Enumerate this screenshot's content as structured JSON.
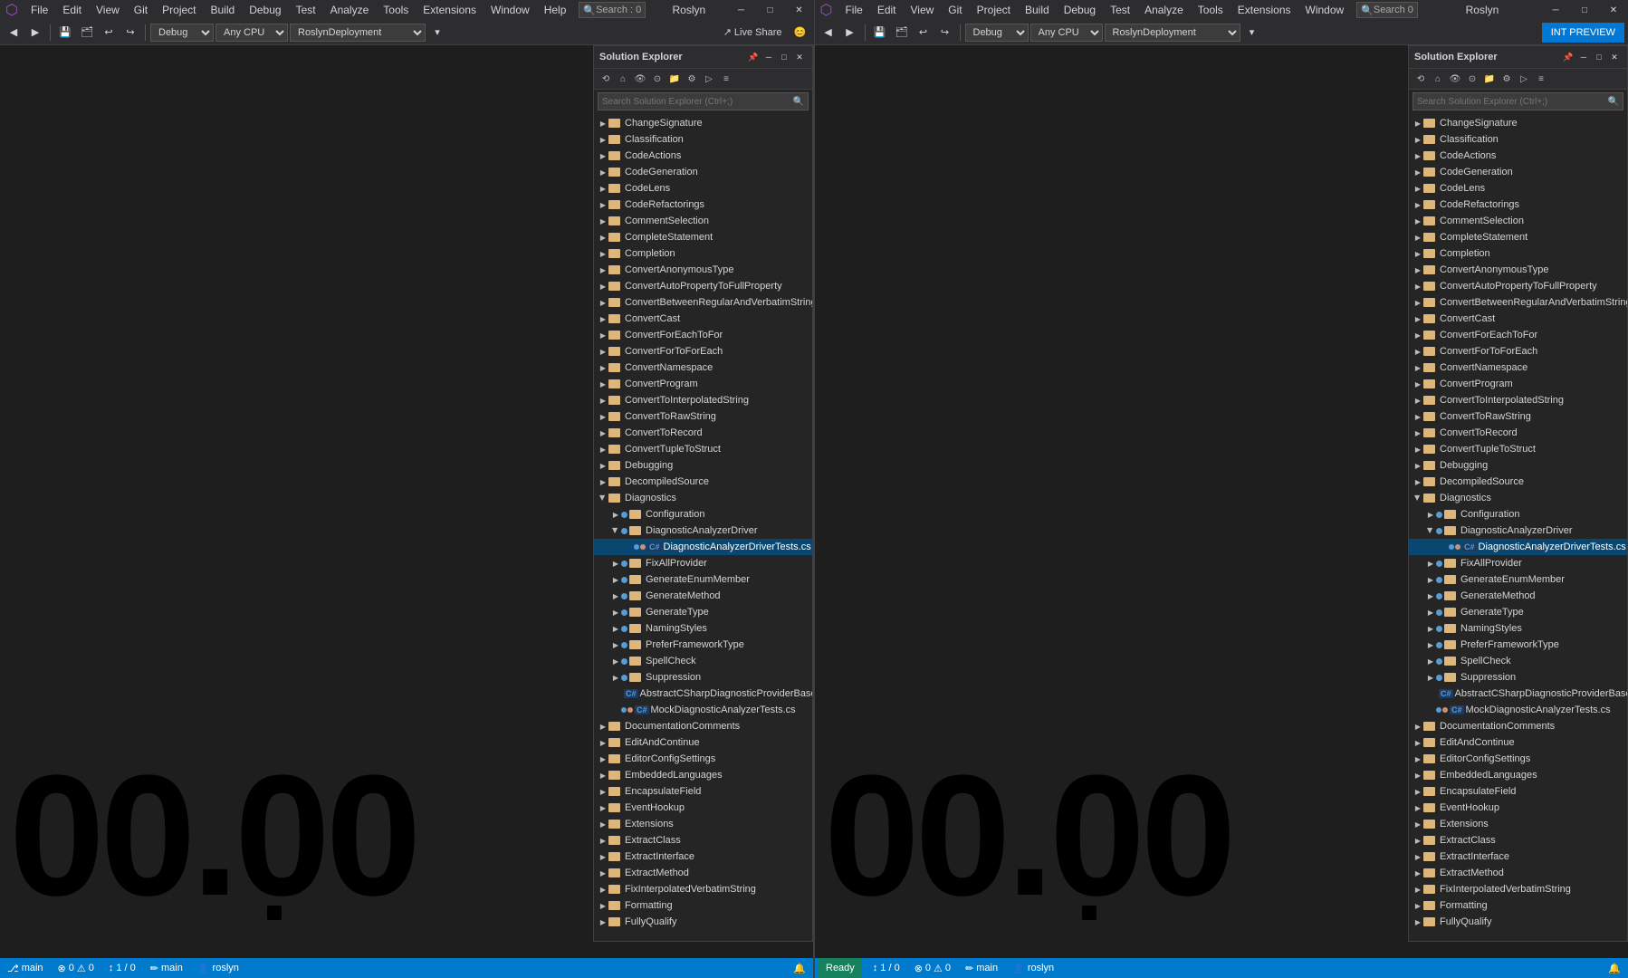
{
  "menuBar": {
    "left": {
      "items": [
        "File",
        "Edit",
        "View",
        "Git",
        "Project",
        "Build",
        "Debug",
        "Test",
        "Analyze",
        "Tools",
        "Extensions",
        "Window",
        "Help"
      ]
    },
    "right": {
      "items": [
        "File",
        "Edit",
        "View",
        "Git",
        "Project",
        "Build",
        "Debug",
        "Test",
        "Analyze",
        "Tools",
        "Extensions",
        "Window"
      ]
    },
    "searchLeft": "Search : 0",
    "searchRight": "Search  0",
    "titleLeft": "Roslyn",
    "titleRight": "Roslyn"
  },
  "toolbar": {
    "debugMode": "Debug",
    "platformLeft": "Any CPU",
    "platformRight": "Any CPU",
    "projectLeft": "RoslynDeployment",
    "projectRight": "RoslynDeployment",
    "liveShare": "Live Share",
    "intPreview": "INT PREVIEW"
  },
  "leftPanel": {
    "solutionExplorer": {
      "title": "Solution Explorer",
      "searchPlaceholder": "Search Solution Explorer (Ctrl+;)",
      "treeItems": [
        {
          "level": 1,
          "type": "folder",
          "label": "ChangeSignature",
          "expanded": false
        },
        {
          "level": 1,
          "type": "folder",
          "label": "Classification",
          "expanded": false
        },
        {
          "level": 1,
          "type": "folder",
          "label": "CodeActions",
          "expanded": false
        },
        {
          "level": 1,
          "type": "folder",
          "label": "CodeGeneration",
          "expanded": false
        },
        {
          "level": 1,
          "type": "folder",
          "label": "CodeLens",
          "expanded": false
        },
        {
          "level": 1,
          "type": "folder",
          "label": "CodeRefactorings",
          "expanded": false
        },
        {
          "level": 1,
          "type": "folder",
          "label": "CommentSelection",
          "expanded": false
        },
        {
          "level": 1,
          "type": "folder",
          "label": "CompleteStatement",
          "expanded": false
        },
        {
          "level": 1,
          "type": "folder",
          "label": "Completion",
          "expanded": false
        },
        {
          "level": 1,
          "type": "folder",
          "label": "ConvertAnonymousType",
          "expanded": false
        },
        {
          "level": 1,
          "type": "folder",
          "label": "ConvertAutoPropertyToFullProperty",
          "expanded": false
        },
        {
          "level": 1,
          "type": "folder",
          "label": "ConvertBetweenRegularAndVerbatimString",
          "expanded": false
        },
        {
          "level": 1,
          "type": "folder",
          "label": "ConvertCast",
          "expanded": false
        },
        {
          "level": 1,
          "type": "folder",
          "label": "ConvertForEachToFor",
          "expanded": false
        },
        {
          "level": 1,
          "type": "folder",
          "label": "ConvertForToForEach",
          "expanded": false
        },
        {
          "level": 1,
          "type": "folder",
          "label": "ConvertNamespace",
          "expanded": false
        },
        {
          "level": 1,
          "type": "folder",
          "label": "ConvertProgram",
          "expanded": false
        },
        {
          "level": 1,
          "type": "folder",
          "label": "ConvertToInterpolatedString",
          "expanded": false
        },
        {
          "level": 1,
          "type": "folder",
          "label": "ConvertToRawString",
          "expanded": false
        },
        {
          "level": 1,
          "type": "folder",
          "label": "ConvertToRecord",
          "expanded": false
        },
        {
          "level": 1,
          "type": "folder",
          "label": "ConvertTupleToStruct",
          "expanded": false
        },
        {
          "level": 1,
          "type": "folder",
          "label": "Debugging",
          "expanded": false
        },
        {
          "level": 1,
          "type": "folder",
          "label": "DecompiledSource",
          "expanded": false
        },
        {
          "level": 1,
          "type": "folder",
          "label": "Diagnostics",
          "expanded": true
        },
        {
          "level": 2,
          "type": "folder",
          "label": "Configuration",
          "expanded": false
        },
        {
          "level": 2,
          "type": "folder",
          "label": "DiagnosticAnalyzerDriver",
          "expanded": true
        },
        {
          "level": 3,
          "type": "csfile",
          "label": "DiagnosticAnalyzerDriverTests.cs",
          "selected": true
        },
        {
          "level": 2,
          "type": "folder",
          "label": "FixAllProvider",
          "expanded": false
        },
        {
          "level": 2,
          "type": "folder",
          "label": "GenerateEnumMember",
          "expanded": false
        },
        {
          "level": 2,
          "type": "folder",
          "label": "GenerateMethod",
          "expanded": false
        },
        {
          "level": 2,
          "type": "folder",
          "label": "GenerateType",
          "expanded": false
        },
        {
          "level": 2,
          "type": "folder",
          "label": "NamingStyles",
          "expanded": false
        },
        {
          "level": 2,
          "type": "folder",
          "label": "PreferFrameworkType",
          "expanded": false
        },
        {
          "level": 2,
          "type": "folder",
          "label": "SpellCheck",
          "expanded": false
        },
        {
          "level": 2,
          "type": "folder",
          "label": "Suppression",
          "expanded": false
        },
        {
          "level": 2,
          "type": "csfile",
          "label": "AbstractCSharpDiagnosticProviderBase",
          "expanded": false
        },
        {
          "level": 2,
          "type": "csfile",
          "label": "MockDiagnosticAnalyzerTests.cs",
          "expanded": false
        },
        {
          "level": 1,
          "type": "folder",
          "label": "DocumentationComments",
          "expanded": false
        },
        {
          "level": 1,
          "type": "folder",
          "label": "EditAndContinue",
          "expanded": false
        },
        {
          "level": 1,
          "type": "folder",
          "label": "EditorConfigSettings",
          "expanded": false
        },
        {
          "level": 1,
          "type": "folder",
          "label": "EmbeddedLanguages",
          "expanded": false
        },
        {
          "level": 1,
          "type": "folder",
          "label": "EncapsulateField",
          "expanded": false
        },
        {
          "level": 1,
          "type": "folder",
          "label": "EventHookup",
          "expanded": false
        },
        {
          "level": 1,
          "type": "folder",
          "label": "Extensions",
          "expanded": false
        },
        {
          "level": 1,
          "type": "folder",
          "label": "ExtractClass",
          "expanded": false
        },
        {
          "level": 1,
          "type": "folder",
          "label": "ExtractInterface",
          "expanded": false
        },
        {
          "level": 1,
          "type": "folder",
          "label": "ExtractMethod",
          "expanded": false
        },
        {
          "level": 1,
          "type": "folder",
          "label": "FixInterpolatedVerbatimString",
          "expanded": false
        },
        {
          "level": 1,
          "type": "folder",
          "label": "Formatting",
          "expanded": false
        },
        {
          "level": 1,
          "type": "folder",
          "label": "FullyQualify",
          "expanded": false
        }
      ]
    },
    "bigNumber": "00.00",
    "statusBar": {
      "branch": "main",
      "user": "roslyn",
      "errors": "0",
      "warnings": "0",
      "lineCol": "1 / 0"
    }
  },
  "rightPanel": {
    "solutionExplorer": {
      "title": "Solution Explorer",
      "searchPlaceholder": "Search Solution Explorer (Ctrl+;)",
      "treeItems": [
        {
          "level": 1,
          "type": "folder",
          "label": "ChangeSignature",
          "expanded": false
        },
        {
          "level": 1,
          "type": "folder",
          "label": "Classification",
          "expanded": false
        },
        {
          "level": 1,
          "type": "folder",
          "label": "CodeActions",
          "expanded": false
        },
        {
          "level": 1,
          "type": "folder",
          "label": "CodeGeneration",
          "expanded": false
        },
        {
          "level": 1,
          "type": "folder",
          "label": "CodeLens",
          "expanded": false
        },
        {
          "level": 1,
          "type": "folder",
          "label": "CodeRefactorings",
          "expanded": false
        },
        {
          "level": 1,
          "type": "folder",
          "label": "CommentSelection",
          "expanded": false
        },
        {
          "level": 1,
          "type": "folder",
          "label": "CompleteStatement",
          "expanded": false
        },
        {
          "level": 1,
          "type": "folder",
          "label": "Completion",
          "expanded": false
        },
        {
          "level": 1,
          "type": "folder",
          "label": "ConvertAnonymousType",
          "expanded": false
        },
        {
          "level": 1,
          "type": "folder",
          "label": "ConvertAutoPropertyToFullProperty",
          "expanded": false
        },
        {
          "level": 1,
          "type": "folder",
          "label": "ConvertBetweenRegularAndVerbatimString",
          "expanded": false
        },
        {
          "level": 1,
          "type": "folder",
          "label": "ConvertCast",
          "expanded": false
        },
        {
          "level": 1,
          "type": "folder",
          "label": "ConvertForEachToFor",
          "expanded": false
        },
        {
          "level": 1,
          "type": "folder",
          "label": "ConvertForToForEach",
          "expanded": false
        },
        {
          "level": 1,
          "type": "folder",
          "label": "ConvertNamespace",
          "expanded": false
        },
        {
          "level": 1,
          "type": "folder",
          "label": "ConvertProgram",
          "expanded": false
        },
        {
          "level": 1,
          "type": "folder",
          "label": "ConvertToInterpolatedString",
          "expanded": false
        },
        {
          "level": 1,
          "type": "folder",
          "label": "ConvertToRawString",
          "expanded": false
        },
        {
          "level": 1,
          "type": "folder",
          "label": "ConvertToRecord",
          "expanded": false
        },
        {
          "level": 1,
          "type": "folder",
          "label": "ConvertTupleToStruct",
          "expanded": false
        },
        {
          "level": 1,
          "type": "folder",
          "label": "Debugging",
          "expanded": false
        },
        {
          "level": 1,
          "type": "folder",
          "label": "DecompiledSource",
          "expanded": false
        },
        {
          "level": 1,
          "type": "folder",
          "label": "Diagnostics",
          "expanded": true
        },
        {
          "level": 2,
          "type": "folder",
          "label": "Configuration",
          "expanded": false
        },
        {
          "level": 2,
          "type": "folder",
          "label": "DiagnosticAnalyzerDriver",
          "expanded": true
        },
        {
          "level": 3,
          "type": "csfile",
          "label": "DiagnosticAnalyzerDriverTests.cs",
          "selected": true
        },
        {
          "level": 2,
          "type": "folder",
          "label": "FixAllProvider",
          "expanded": false
        },
        {
          "level": 2,
          "type": "folder",
          "label": "GenerateEnumMember",
          "expanded": false
        },
        {
          "level": 2,
          "type": "folder",
          "label": "GenerateMethod",
          "expanded": false
        },
        {
          "level": 2,
          "type": "folder",
          "label": "GenerateType",
          "expanded": false
        },
        {
          "level": 2,
          "type": "folder",
          "label": "NamingStyles",
          "expanded": false
        },
        {
          "level": 2,
          "type": "folder",
          "label": "PreferFrameworkType",
          "expanded": false
        },
        {
          "level": 2,
          "type": "folder",
          "label": "SpellCheck",
          "expanded": false
        },
        {
          "level": 2,
          "type": "folder",
          "label": "Suppression",
          "expanded": false
        },
        {
          "level": 2,
          "type": "csfile",
          "label": "AbstractCSharpDiagnosticProviderBase",
          "expanded": false
        },
        {
          "level": 2,
          "type": "csfile",
          "label": "MockDiagnosticAnalyzerTests.cs",
          "expanded": false
        },
        {
          "level": 1,
          "type": "folder",
          "label": "DocumentationComments",
          "expanded": false
        },
        {
          "level": 1,
          "type": "folder",
          "label": "EditAndContinue",
          "expanded": false
        },
        {
          "level": 1,
          "type": "folder",
          "label": "EditorConfigSettings",
          "expanded": false
        },
        {
          "level": 1,
          "type": "folder",
          "label": "EmbeddedLanguages",
          "expanded": false
        },
        {
          "level": 1,
          "type": "folder",
          "label": "EncapsulateField",
          "expanded": false
        },
        {
          "level": 1,
          "type": "folder",
          "label": "EventHookup",
          "expanded": false
        },
        {
          "level": 1,
          "type": "folder",
          "label": "Extensions",
          "expanded": false
        },
        {
          "level": 1,
          "type": "folder",
          "label": "ExtractClass",
          "expanded": false
        },
        {
          "level": 1,
          "type": "folder",
          "label": "ExtractInterface",
          "expanded": false
        },
        {
          "level": 1,
          "type": "folder",
          "label": "ExtractMethod",
          "expanded": false
        },
        {
          "level": 1,
          "type": "folder",
          "label": "FixInterpolatedVerbatimString",
          "expanded": false
        },
        {
          "level": 1,
          "type": "folder",
          "label": "Formatting",
          "expanded": false
        },
        {
          "level": 1,
          "type": "folder",
          "label": "FullyQualify",
          "expanded": false
        }
      ]
    },
    "bigNumber": "00.00",
    "statusBar": {
      "branch": "main",
      "user": "roslyn",
      "errors": "0",
      "warnings": "0",
      "lineCol": "1 / 0",
      "ready": "Ready"
    }
  },
  "colors": {
    "accent": "#007acc",
    "background": "#1e1e1e",
    "panelBg": "#252526",
    "selected": "#094771"
  }
}
